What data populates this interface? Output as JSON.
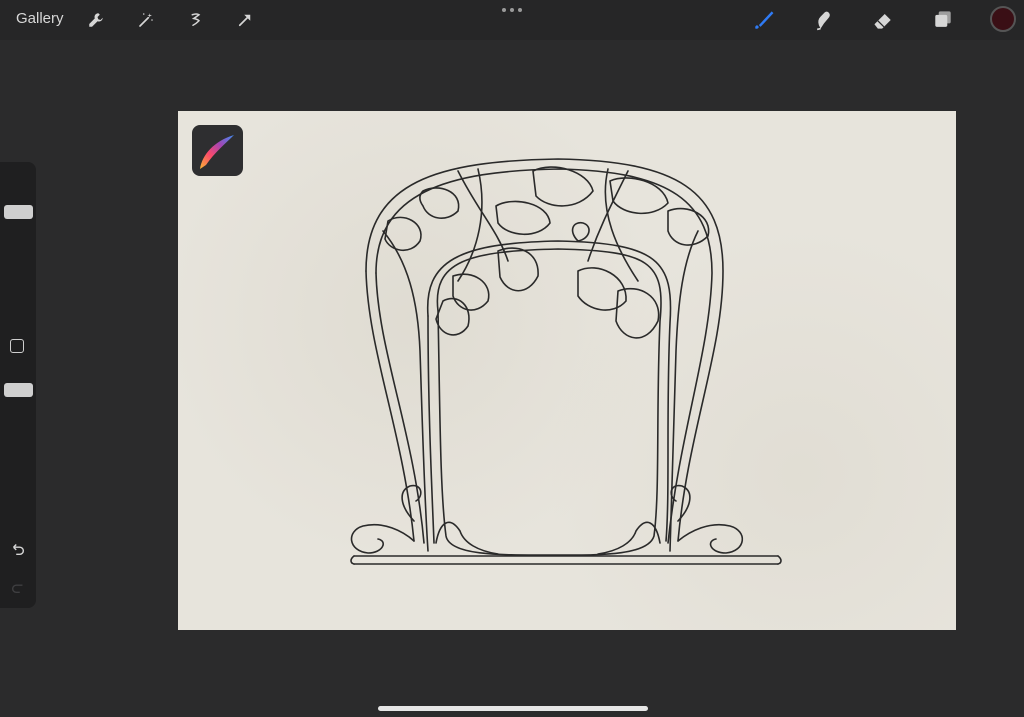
{
  "app": {
    "gallery_label": "Gallery"
  },
  "toolbar": {
    "left_icons": [
      "wrench-icon",
      "magic-wand-icon",
      "selection-icon",
      "transform-arrow-icon"
    ],
    "more_menu": "more-dots-icon",
    "right_tools": [
      "brush-icon",
      "smudge-icon",
      "eraser-icon",
      "layers-icon"
    ],
    "active_tool": "brush-icon",
    "current_color": "#3a0f15",
    "accent_color": "#2f7bf5"
  },
  "sidebar": {
    "brush_size_level": 0.15,
    "opacity_level": 0.15,
    "modify_button": "square-icon",
    "undo": "undo-icon",
    "redo": "redo-icon"
  },
  "canvas": {
    "artwork": "art-nouveau-arch-frame",
    "paper_color": "#e7e4dc",
    "line_color": "#2a2a2a"
  }
}
